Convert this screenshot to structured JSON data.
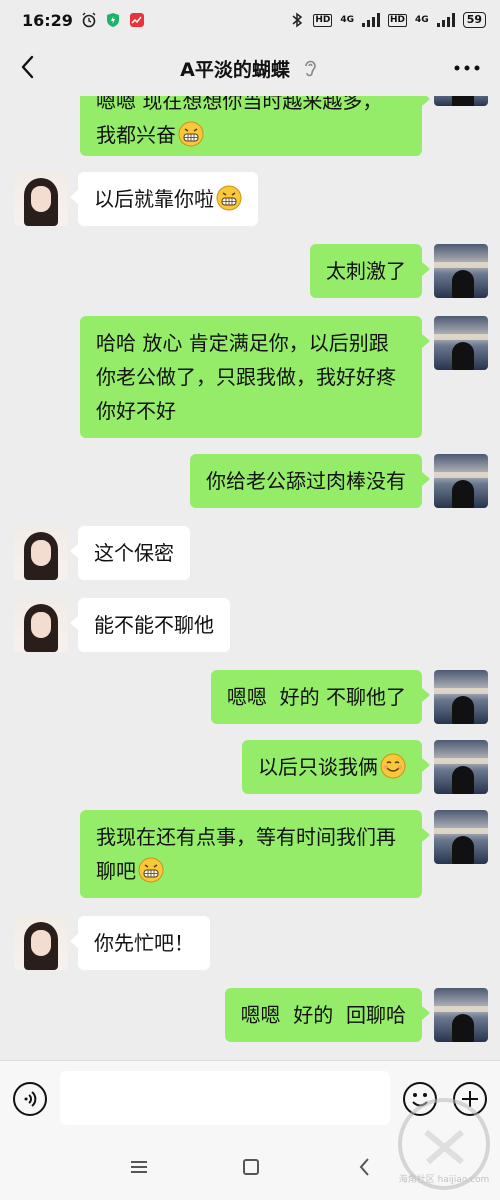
{
  "status_bar": {
    "time": "16:29",
    "network_1": "4G",
    "network_2": "4G",
    "battery": "59"
  },
  "header": {
    "title": "A平淡的蝴蝶"
  },
  "messages": [
    {
      "side": "right",
      "text": "嗯嗯 现在想想你当时越来越多，",
      "text2": "我都兴奋",
      "emoji": "grin-emoji"
    },
    {
      "side": "left",
      "text": "以后就靠你啦",
      "emoji": "grin-emoji"
    },
    {
      "side": "right",
      "text": "太刺激了"
    },
    {
      "side": "right",
      "text": "哈哈  放心  肯定满足你，以后别跟",
      "text2": "你老公做了，只跟我做，我好好疼",
      "text3": "你好不好"
    },
    {
      "side": "right",
      "text": "你给老公舔过肉棒没有"
    },
    {
      "side": "left",
      "text": "这个保密"
    },
    {
      "side": "left",
      "text": "能不能不聊他"
    },
    {
      "side": "right",
      "text": "嗯嗯  好的 不聊他了"
    },
    {
      "side": "right",
      "text": "以后只谈我俩",
      "emoji": "smile-emoji"
    },
    {
      "side": "right",
      "text": "我现在还有点事，等有时间我们再",
      "text2": "聊吧",
      "emoji": "grin-emoji"
    },
    {
      "side": "left",
      "text": "你先忙吧！"
    },
    {
      "side": "right",
      "text": "嗯嗯  好的  回聊哈"
    }
  ],
  "input": {
    "value": "",
    "placeholder": ""
  },
  "watermark": {
    "text": "海角社区 haijiao.com"
  },
  "colors": {
    "sent_bubble": "#95ec69",
    "received_bubble": "#ffffff",
    "background": "#ededed"
  }
}
